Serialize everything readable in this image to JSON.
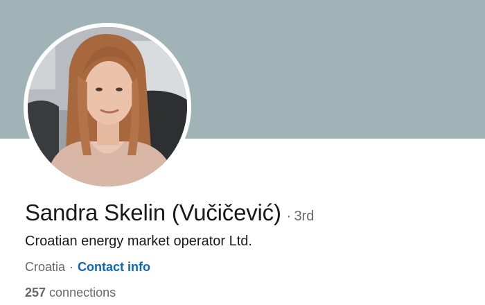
{
  "profile": {
    "name": "Sandra Skelin (Vučičević)",
    "degree_separator": "·",
    "degree": "3rd",
    "headline": "Croatian energy market operator Ltd.",
    "location": "Croatia",
    "location_separator": "·",
    "contact_link": "Contact info",
    "connections_count": "257",
    "connections_label": "connections"
  },
  "colors": {
    "cover": "#a0b4b7",
    "link": "#0a66c2",
    "text_primary": "#000000e6",
    "text_secondary": "#00000099"
  }
}
